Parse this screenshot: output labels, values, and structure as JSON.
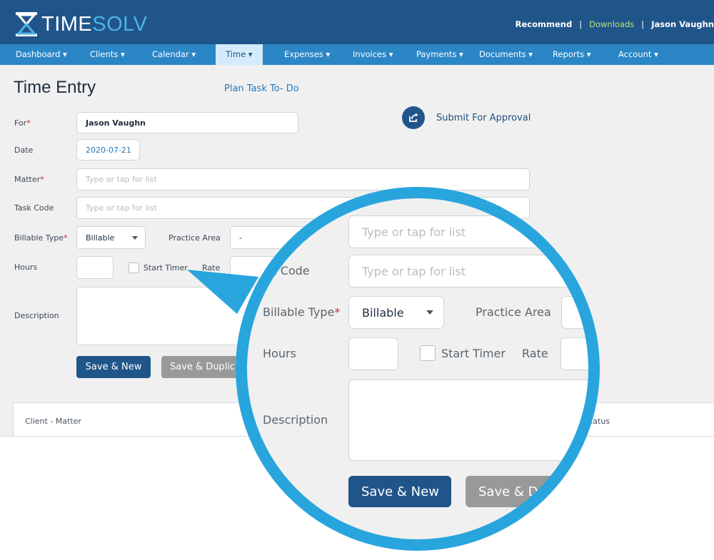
{
  "header": {
    "logo_time": "TIME",
    "logo_solv": "SOLV",
    "links": {
      "recommend": "Recommend",
      "downloads": "Downloads",
      "user": "Jason Vaughn",
      "separator": "|"
    }
  },
  "nav": {
    "items": [
      {
        "label": "Dashboard ▾"
      },
      {
        "label": "Clients ▾"
      },
      {
        "label": "Calendar ▾"
      },
      {
        "label": "Time ▾"
      },
      {
        "label": "Expenses ▾"
      },
      {
        "label": "Invoices ▾"
      },
      {
        "label": "Payments ▾"
      },
      {
        "label": "Documents ▾"
      },
      {
        "label": "Reports ▾"
      },
      {
        "label": "Account ▾"
      }
    ],
    "active": "Time"
  },
  "page": {
    "title": "Time Entry",
    "plan_link": "Plan Task To- Do",
    "submit_approval": "Submit For Approval"
  },
  "form": {
    "for_label": "For",
    "for_value": "Jason Vaughn",
    "date_label": "Date",
    "date_value": "2020-07-21",
    "matter_label": "Matter",
    "matter_placeholder": "Type or tap for list",
    "task_code_label": "Task Code",
    "task_code_placeholder": "Type or tap for list",
    "billable_type_label": "Billable Type",
    "billable_type_value": "Billable",
    "practice_area_label": "Practice Area",
    "practice_area_value": "-",
    "hours_label": "Hours",
    "start_timer_label": "Start Timer",
    "rate_label": "Rate",
    "description_label": "Description",
    "required_mark": "*",
    "save_new": "Save & New",
    "save_duplicate": "Save & Duplica"
  },
  "grid": {
    "col_client_matter": "Client - Matter",
    "col_status": "Status"
  },
  "magnifier": {
    "matter_placeholder": "Type or tap for list",
    "task_code_label": "sk Code",
    "task_code_placeholder": "Type or tap for list",
    "billable_type_label": "Billable Type",
    "billable_type_value": "Billable",
    "practice_area_label": "Practice Area",
    "hours_label": "Hours",
    "start_timer_label": "Start Timer",
    "rate_label": "Rate",
    "description_label": "Description",
    "save_new": "Save & New",
    "save_partial": "Save & D"
  },
  "colors": {
    "header_bg": "#20558a",
    "nav_bg": "#2b86c6",
    "nav_active_bg": "#d4ecfa",
    "accent": "#29a5dd",
    "primary_button": "#20558a",
    "required": "#c9252c"
  }
}
